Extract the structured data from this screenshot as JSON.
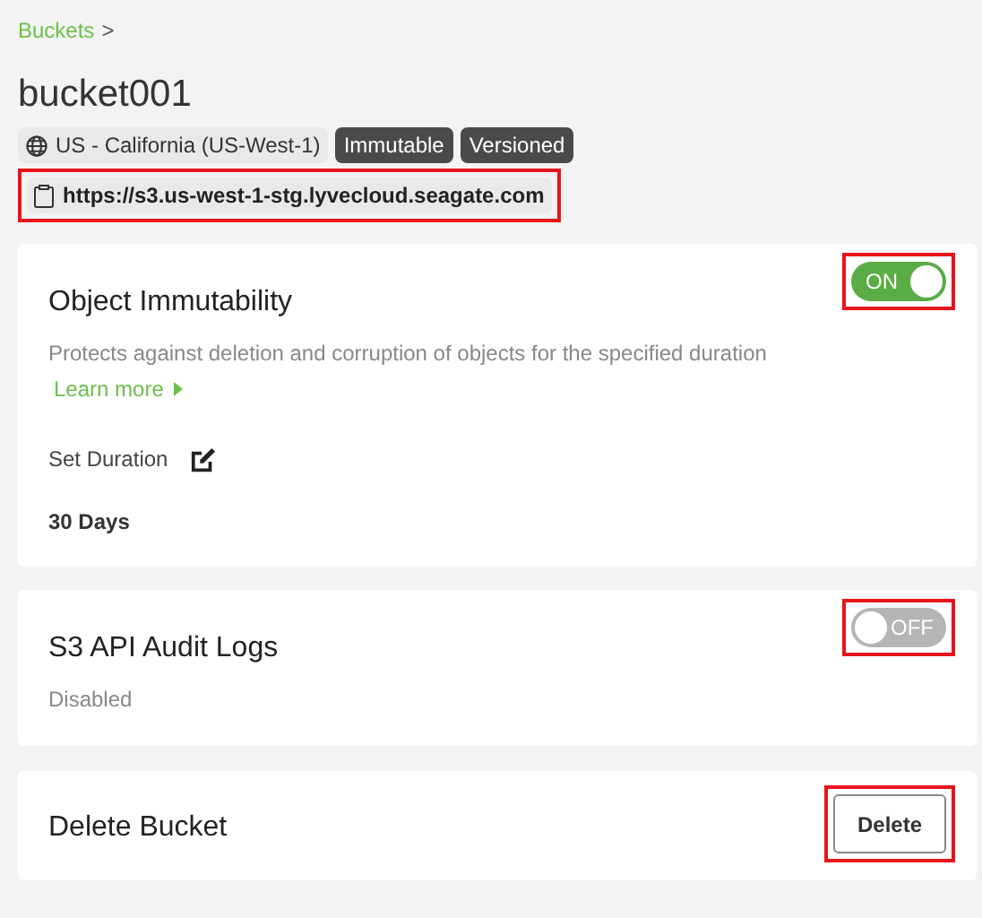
{
  "breadcrumb": {
    "label": "Buckets",
    "separator": ">"
  },
  "title": "bucket001",
  "region": {
    "label": "US - California (US-West-1)"
  },
  "tags": [
    "Immutable",
    "Versioned"
  ],
  "endpoint": {
    "url": "https://s3.us-west-1-stg.lyvecloud.seagate.com",
    "highlighted": true
  },
  "sections": [
    {
      "kind": "toggle",
      "title": "Object Immutability",
      "description": "Protects against deletion and corruption of objects for the specified duration",
      "link": "Learn more",
      "toggle": {
        "on": true,
        "label": "ON",
        "highlighted": true
      },
      "field_label": "Set Duration",
      "value": "30 Days"
    },
    {
      "kind": "toggle",
      "title": "S3 API Audit Logs",
      "description": "Disabled",
      "toggle": {
        "on": false,
        "label": "OFF"
      },
      "callout": true
    },
    {
      "kind": "action",
      "title": "Delete Bucket",
      "button": {
        "label": "Delete",
        "highlighted": true
      }
    }
  ]
}
